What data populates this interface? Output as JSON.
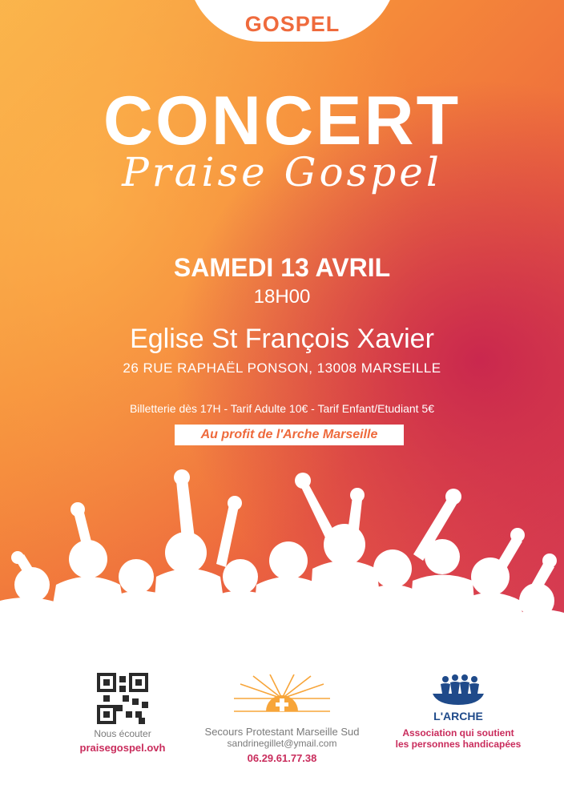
{
  "header": {
    "tag": "GOSPEL"
  },
  "title": {
    "main": "CONCERT",
    "script": "Praise Gospel"
  },
  "event": {
    "date": "SAMEDI 13 AVRIL",
    "time": "18H00",
    "venue": "Eglise St François Xavier",
    "address": "26 RUE RAPHAËL PONSON, 13008 MARSEILLE",
    "tickets": "Billetterie dès 17H - Tarif Adulte 10€ - Tarif Enfant/Etudiant 5€",
    "benefit": "Au profit de l'Arche Marseille"
  },
  "footer": {
    "left": {
      "line1": "Nous écouter",
      "line2": "praisegospel.ovh"
    },
    "center": {
      "org": "Secours Protestant Marseille Sud",
      "email": "sandrinegillet@ymail.com",
      "phone": "06.29.61.77.38"
    },
    "right": {
      "logo_text": "L'ARCHE",
      "line1": "Association qui soutient",
      "line2": "les personnes handicapées"
    }
  },
  "colors": {
    "accent": "#ee6a3c",
    "crimson": "#c92c5c",
    "navy": "#1f4a8a",
    "sun": "#f7a53a"
  }
}
